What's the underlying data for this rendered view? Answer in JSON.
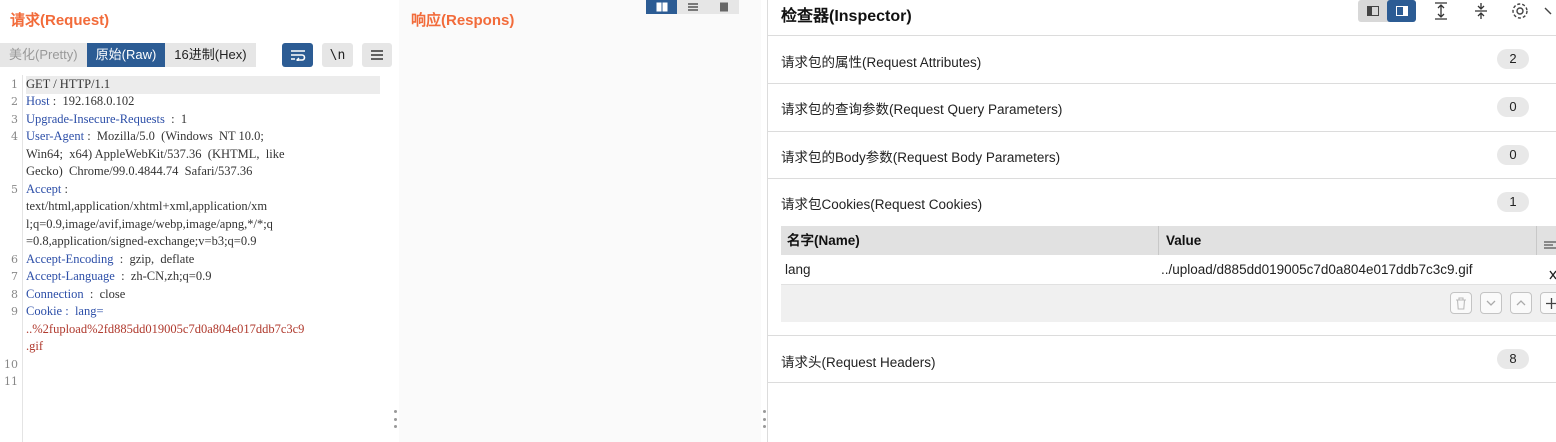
{
  "request": {
    "title": "请求(Request)",
    "tabs": [
      "美化(Pretty)",
      "原始(Raw)",
      "16进制(Hex)"
    ],
    "active_tab": "原始(Raw)",
    "newline_btn": "\\n",
    "line_numbers": [
      "1",
      "2",
      "3",
      "4",
      "5",
      "6",
      "7",
      "8",
      "9",
      "10",
      "11"
    ],
    "lines": {
      "l1": "GET / HTTP/1.1",
      "l2k": "Host",
      "l2v": " :  192.168.0.102",
      "l3k": "Upgrade-Insecure-Requests",
      "l3v": "  :  1",
      "l4k": "User-Agent",
      "l4v": " :  Mozilla/5.0  (Windows  NT 10.0;",
      "l4b": "Win64;  x64) AppleWebKit/537.36  (KHTML,  like",
      "l4c": "Gecko)  Chrome/99.0.4844.74  Safari/537.36",
      "l5k": "Accept",
      "l5v": " :",
      "l5b": "text/html,application/xhtml+xml,application/xm",
      "l5c": "l;q=0.9,image/avif,image/webp,image/apng,*/*;q",
      "l5d": "=0.8,application/signed-exchange;v=b3;q=0.9",
      "l6k": "Accept-Encoding",
      "l6v": "  :  gzip,  deflate",
      "l7k": "Accept-Language",
      "l7v": "  :  zh-CN,zh;q=0.9",
      "l8k": "Connection",
      "l8v": "  :  close",
      "l9k": "Cookie",
      "l9v": " :  lang=",
      "l9b": "..%2fupload%2fd885dd019005c7d0a804e017ddb7c3c9",
      "l9c": ".gif"
    }
  },
  "response": {
    "title": "响应(Respons)"
  },
  "inspector": {
    "title": "检查器(Inspector)",
    "sections": {
      "attributes": {
        "label": "请求包的属性(Request Attributes)",
        "count": "2"
      },
      "query": {
        "label": "请求包的查询参数(Request Query Parameters)",
        "count": "0"
      },
      "body": {
        "label": "请求包的Body参数(Request Body Parameters)",
        "count": "0"
      },
      "cookies": {
        "label": "请求包Cookies(Request Cookies)",
        "count": "1"
      },
      "headers": {
        "label": "请求头(Request Headers)",
        "count": "8"
      }
    },
    "cookie_table": {
      "col_name": "名字(Name)",
      "col_value": "Value",
      "rows": [
        {
          "name": "lang",
          "value": "../upload/d885dd019005c7d0a804e017ddb7c3c9.gif"
        }
      ]
    }
  },
  "colors": {
    "title_orange": "#f26b3a",
    "accent_blue": "#2c5c94",
    "header_key_blue": "#2d4fa8",
    "cookie_value_red": "#b03a2e"
  }
}
